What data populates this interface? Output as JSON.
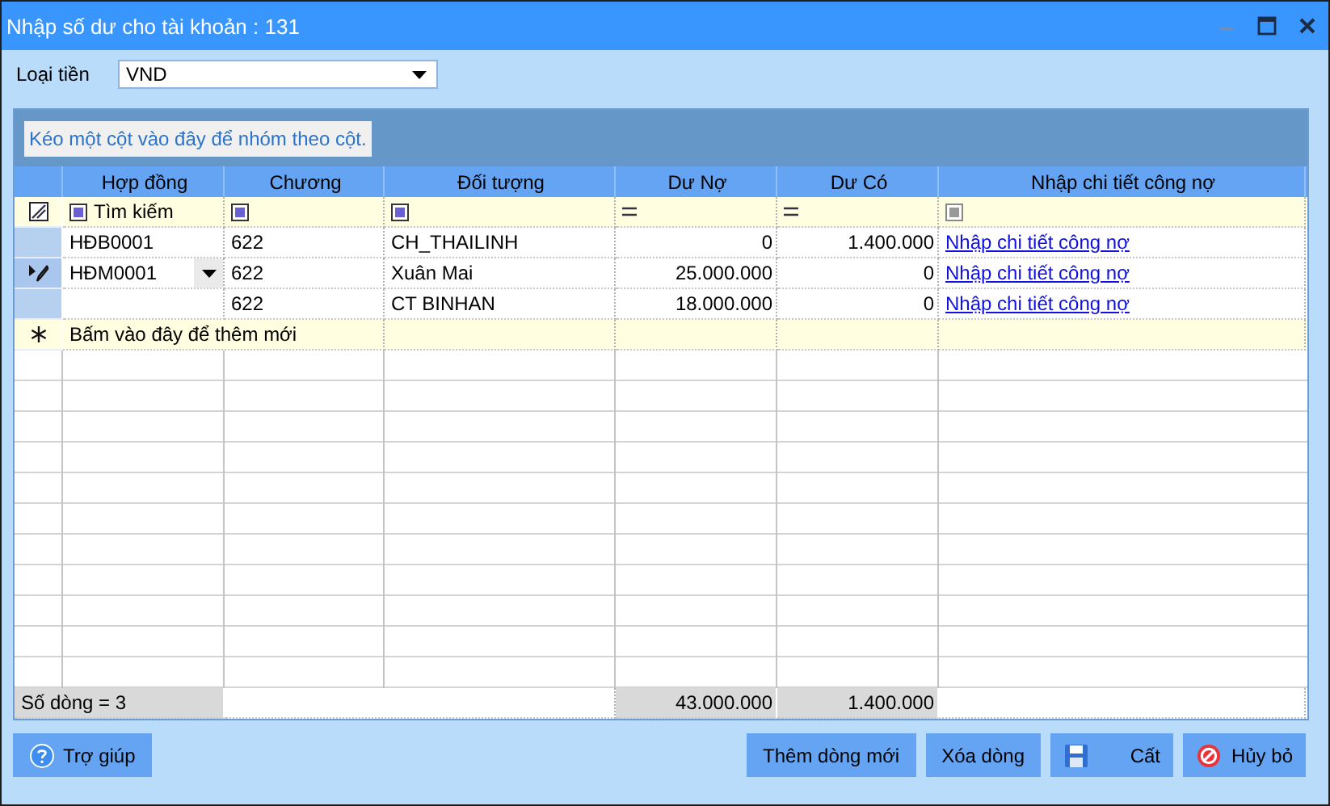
{
  "window": {
    "title": "Nhập số dư cho tài khoản : 131"
  },
  "currency": {
    "label": "Loại tiền",
    "value": "VND"
  },
  "group_panel": {
    "hint": "Kéo một cột vào đây để nhóm theo cột."
  },
  "table": {
    "columns": [
      {
        "label": "Hợp đồng",
        "kind": "text",
        "filter_text": "Tìm kiếm"
      },
      {
        "label": "Chương",
        "kind": "text"
      },
      {
        "label": "Đối tượng",
        "kind": "text"
      },
      {
        "label": "Dư Nợ",
        "kind": "number"
      },
      {
        "label": "Dư Có",
        "kind": "number"
      },
      {
        "label": "Nhập chi tiết công nợ",
        "kind": "link"
      }
    ],
    "rows": [
      {
        "editing": false,
        "cells": [
          "HĐB0001",
          "622",
          "CH_THAILINH",
          "0",
          "1.400.000"
        ],
        "link": "Nhập chi tiết công nợ"
      },
      {
        "editing": true,
        "cells": [
          "HĐM0001",
          "622",
          "Xuân Mai",
          "25.000.000",
          "0"
        ],
        "link": "Nhập chi tiết công nợ"
      },
      {
        "editing": false,
        "cells": [
          "",
          "622",
          "CT BINHAN",
          "18.000.000",
          "0"
        ],
        "link": "Nhập chi tiết công nợ"
      }
    ],
    "new_row": "Bấm vào đây để thêm mới",
    "footer": {
      "count": "Số dòng = 3",
      "debit_total": "43.000.000",
      "credit_total": "1.400.000"
    }
  },
  "buttons": [
    {
      "label": "Trợ giúp",
      "kind": "help"
    },
    {
      "label": "Thêm dòng mới",
      "kind": "plain"
    },
    {
      "label": "Xóa dòng",
      "kind": "plain"
    },
    {
      "label": "Cất",
      "kind": "save"
    },
    {
      "label": "Hủy bỏ",
      "kind": "cancel"
    }
  ]
}
